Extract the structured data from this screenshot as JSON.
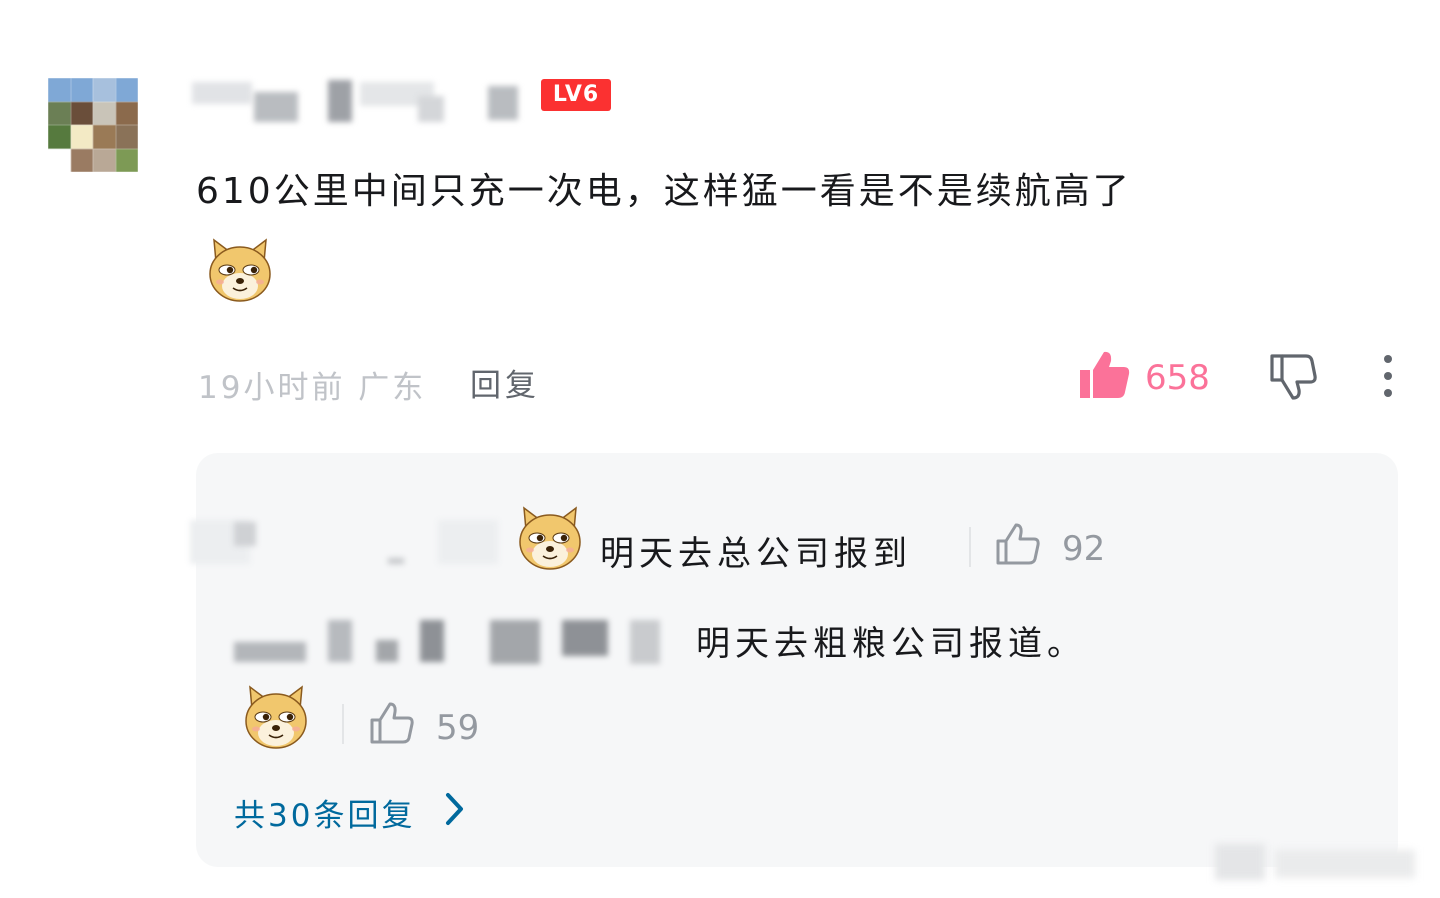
{
  "comment": {
    "level_badge": "LV6",
    "text": "610公里中间只充一次电，这样猛一看是不是续航高了",
    "emoji": "doge-emoji",
    "meta": "19小时前 广东",
    "reply_label": "回复",
    "like_count": "658",
    "liked": true
  },
  "replies": [
    {
      "text": "明天去总公司报到",
      "like_count": "92"
    },
    {
      "text": "明天去粗粮公司报道。",
      "like_count": "59"
    }
  ],
  "more_replies_label": "共30条回复",
  "colors": {
    "accent_pink": "#fb7299",
    "link_blue": "#00699d",
    "level_red": "#fb3131",
    "meta_gray": "#c0c3c8",
    "reply_bg": "#f6f7f8"
  },
  "icons": [
    "thumbs-up-filled-icon",
    "thumbs-down-icon",
    "more-vertical-icon",
    "thumbs-up-outline-icon",
    "chevron-right-icon",
    "doge-emoji"
  ]
}
